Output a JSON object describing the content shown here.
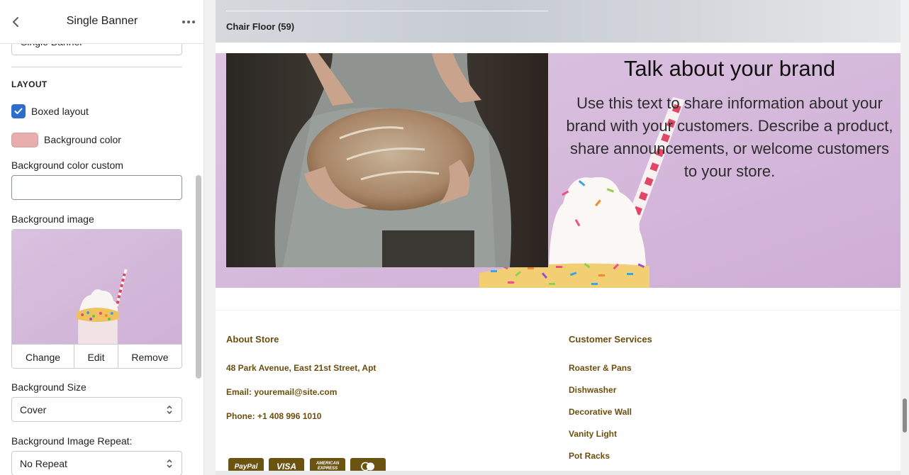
{
  "panel": {
    "title": "Single Banner",
    "name_value": "Single Banner",
    "section_heading": "LAYOUT",
    "boxed_layout": {
      "label": "Boxed layout",
      "checked": true
    },
    "background_color": {
      "label": "Background color",
      "swatch": "#e8aeae"
    },
    "background_color_custom": {
      "label": "Background color custom",
      "value": ""
    },
    "background_image": {
      "label": "Background image",
      "change_label": "Change",
      "edit_label": "Edit",
      "remove_label": "Remove"
    },
    "background_size": {
      "label": "Background Size",
      "value": "Cover"
    },
    "background_repeat": {
      "label": "Background Image Repeat:",
      "value": "No Repeat"
    }
  },
  "preview": {
    "hero": {
      "title": "Chair Floor (59)"
    },
    "banner": {
      "title": "Talk about your brand",
      "text": "Use this text to share information about your brand with your customers. Describe a product, share announcements, or welcome customers to your store."
    },
    "footer": {
      "about": {
        "heading": "About Store",
        "address": "48 Park Avenue, East 21st Street, Apt",
        "email": "Email: youremail@site.com",
        "phone": "Phone: +1 408 996 1010"
      },
      "services": {
        "heading": "Customer Services",
        "links": [
          "Roaster & Pans",
          "Dishwasher",
          "Decorative Wall",
          "Vanity Light",
          "Pot Racks"
        ]
      },
      "payments": [
        "PayPal",
        "VISA",
        "AMERICAN EXPRESS"
      ]
    }
  },
  "colors": {
    "accent": "#2c6ecb",
    "footer_text": "#6b4e0f",
    "banner_bg": "#d6bcdc"
  }
}
